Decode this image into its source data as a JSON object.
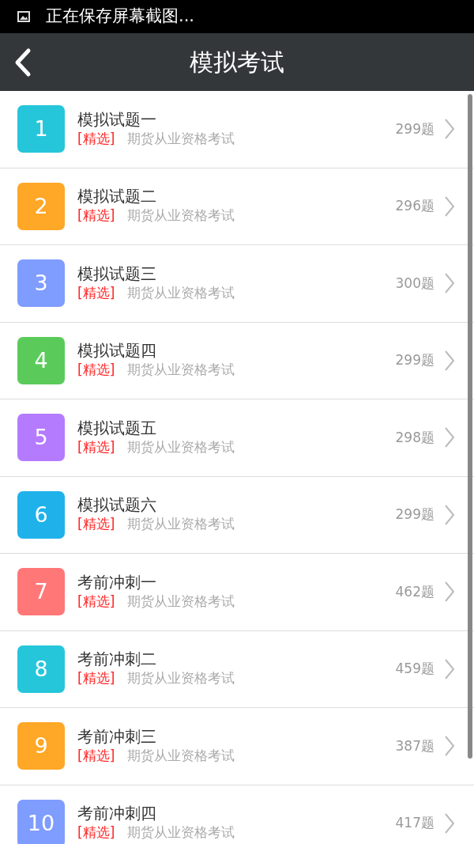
{
  "status_bar": {
    "notification": "正在保存屏幕截图..."
  },
  "header": {
    "title": "模拟考试"
  },
  "exams": [
    {
      "number": "1",
      "color": "#26c6da",
      "title": "模拟试题一",
      "tag": "[精选]",
      "subtitle": "期货从业资格考试",
      "count": "299题"
    },
    {
      "number": "2",
      "color": "#ffa726",
      "title": "模拟试题二",
      "tag": "[精选]",
      "subtitle": "期货从业资格考试",
      "count": "296题"
    },
    {
      "number": "3",
      "color": "#7f9cff",
      "title": "模拟试题三",
      "tag": "[精选]",
      "subtitle": "期货从业资格考试",
      "count": "300题"
    },
    {
      "number": "4",
      "color": "#5acb5a",
      "title": "模拟试题四",
      "tag": "[精选]",
      "subtitle": "期货从业资格考试",
      "count": "299题"
    },
    {
      "number": "5",
      "color": "#b57bff",
      "title": "模拟试题五",
      "tag": "[精选]",
      "subtitle": "期货从业资格考试",
      "count": "298题"
    },
    {
      "number": "6",
      "color": "#1fb2ea",
      "title": "模拟试题六",
      "tag": "[精选]",
      "subtitle": "期货从业资格考试",
      "count": "299题"
    },
    {
      "number": "7",
      "color": "#ff7777",
      "title": "考前冲刺一",
      "tag": "[精选]",
      "subtitle": "期货从业资格考试",
      "count": "462题"
    },
    {
      "number": "8",
      "color": "#26c6da",
      "title": "考前冲刺二",
      "tag": "[精选]",
      "subtitle": "期货从业资格考试",
      "count": "459题"
    },
    {
      "number": "9",
      "color": "#ffa726",
      "title": "考前冲刺三",
      "tag": "[精选]",
      "subtitle": "期货从业资格考试",
      "count": "387题"
    },
    {
      "number": "10",
      "color": "#7f9cff",
      "title": "考前冲刺四",
      "tag": "[精选]",
      "subtitle": "期货从业资格考试",
      "count": "417题"
    }
  ]
}
